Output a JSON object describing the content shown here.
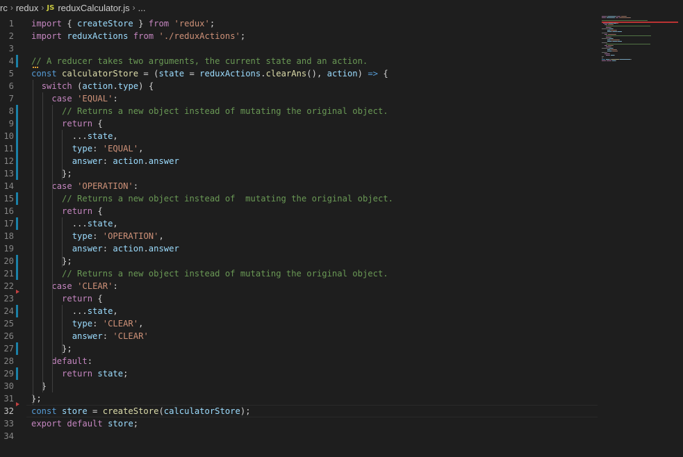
{
  "breadcrumb": {
    "items": [
      "rc",
      "redux",
      "reduxCalculator.js",
      "..."
    ],
    "js_badge": "JS"
  },
  "editor": {
    "lines": [
      {
        "n": "1",
        "tokens": [
          [
            "k",
            "import"
          ],
          [
            "p",
            " { "
          ],
          [
            "v",
            "createStore"
          ],
          [
            "p",
            " } "
          ],
          [
            "k",
            "from"
          ],
          [
            "p",
            " "
          ],
          [
            "s",
            "'redux'"
          ],
          [
            "p",
            ";"
          ]
        ]
      },
      {
        "n": "2",
        "tokens": [
          [
            "k",
            "import"
          ],
          [
            "p",
            " "
          ],
          [
            "v",
            "reduxActions"
          ],
          [
            "p",
            " "
          ],
          [
            "k",
            "from"
          ],
          [
            "p",
            " "
          ],
          [
            "s",
            "'./reduxActions'"
          ],
          [
            "p",
            ";"
          ]
        ]
      },
      {
        "n": "3",
        "tokens": []
      },
      {
        "n": "4",
        "tokens": [
          [
            "c",
            "// A reducer takes two arguments, the current state and an action."
          ]
        ]
      },
      {
        "n": "5",
        "tokens": [
          [
            "b",
            "const"
          ],
          [
            "p",
            " "
          ],
          [
            "f",
            "calculatorStore"
          ],
          [
            "p",
            " = ("
          ],
          [
            "v",
            "state"
          ],
          [
            "p",
            " = "
          ],
          [
            "v",
            "reduxActions"
          ],
          [
            "p",
            "."
          ],
          [
            "f",
            "clearAns"
          ],
          [
            "p",
            "(), "
          ],
          [
            "v",
            "action"
          ],
          [
            "p",
            ") "
          ],
          [
            "b",
            "=>"
          ],
          [
            "p",
            " {"
          ]
        ]
      },
      {
        "n": "6",
        "tokens": [
          [
            "p",
            "  "
          ],
          [
            "k",
            "switch"
          ],
          [
            "p",
            " ("
          ],
          [
            "v",
            "action"
          ],
          [
            "p",
            "."
          ],
          [
            "v",
            "type"
          ],
          [
            "p",
            ") {"
          ]
        ]
      },
      {
        "n": "7",
        "tokens": [
          [
            "p",
            "    "
          ],
          [
            "k",
            "case"
          ],
          [
            "p",
            " "
          ],
          [
            "s",
            "'EQUAL'"
          ],
          [
            "p",
            ":"
          ]
        ]
      },
      {
        "n": "8",
        "tokens": [
          [
            "p",
            "      "
          ],
          [
            "c",
            "// Returns a new object instead of mutating the original object."
          ]
        ]
      },
      {
        "n": "9",
        "tokens": [
          [
            "p",
            "      "
          ],
          [
            "k",
            "return"
          ],
          [
            "p",
            " {"
          ]
        ]
      },
      {
        "n": "10",
        "tokens": [
          [
            "p",
            "        ..."
          ],
          [
            "v",
            "state"
          ],
          [
            "p",
            ","
          ]
        ]
      },
      {
        "n": "11",
        "tokens": [
          [
            "p",
            "        "
          ],
          [
            "v",
            "type"
          ],
          [
            "p",
            ": "
          ],
          [
            "s",
            "'EQUAL'"
          ],
          [
            "p",
            ","
          ]
        ]
      },
      {
        "n": "12",
        "tokens": [
          [
            "p",
            "        "
          ],
          [
            "v",
            "answer"
          ],
          [
            "p",
            ": "
          ],
          [
            "v",
            "action"
          ],
          [
            "p",
            "."
          ],
          [
            "v",
            "answer"
          ]
        ]
      },
      {
        "n": "13",
        "tokens": [
          [
            "p",
            "      };"
          ]
        ]
      },
      {
        "n": "14",
        "tokens": [
          [
            "p",
            "    "
          ],
          [
            "k",
            "case"
          ],
          [
            "p",
            " "
          ],
          [
            "s",
            "'OPERATION'"
          ],
          [
            "p",
            ":"
          ]
        ]
      },
      {
        "n": "15",
        "tokens": [
          [
            "p",
            "      "
          ],
          [
            "c",
            "// Returns a new object instead of  mutating the original object."
          ]
        ]
      },
      {
        "n": "16",
        "tokens": [
          [
            "p",
            "      "
          ],
          [
            "k",
            "return"
          ],
          [
            "p",
            " {"
          ]
        ]
      },
      {
        "n": "17",
        "tokens": [
          [
            "p",
            "        ..."
          ],
          [
            "v",
            "state"
          ],
          [
            "p",
            ","
          ]
        ]
      },
      {
        "n": "18",
        "tokens": [
          [
            "p",
            "        "
          ],
          [
            "v",
            "type"
          ],
          [
            "p",
            ": "
          ],
          [
            "s",
            "'OPERATION'"
          ],
          [
            "p",
            ","
          ]
        ]
      },
      {
        "n": "19",
        "tokens": [
          [
            "p",
            "        "
          ],
          [
            "v",
            "answer"
          ],
          [
            "p",
            ": "
          ],
          [
            "v",
            "action"
          ],
          [
            "p",
            "."
          ],
          [
            "v",
            "answer"
          ]
        ]
      },
      {
        "n": "20",
        "tokens": [
          [
            "p",
            "      };"
          ]
        ]
      },
      {
        "n": "21",
        "tokens": [
          [
            "p",
            "      "
          ],
          [
            "c",
            "// Returns a new object instead of mutating the original object."
          ]
        ]
      },
      {
        "n": "22",
        "tokens": [
          [
            "p",
            "    "
          ],
          [
            "k",
            "case"
          ],
          [
            "p",
            " "
          ],
          [
            "s",
            "'CLEAR'"
          ],
          [
            "p",
            ":"
          ]
        ]
      },
      {
        "n": "23",
        "tokens": [
          [
            "p",
            "      "
          ],
          [
            "k",
            "return"
          ],
          [
            "p",
            " {"
          ]
        ]
      },
      {
        "n": "24",
        "tokens": [
          [
            "p",
            "        ..."
          ],
          [
            "v",
            "state"
          ],
          [
            "p",
            ","
          ]
        ]
      },
      {
        "n": "25",
        "tokens": [
          [
            "p",
            "        "
          ],
          [
            "v",
            "type"
          ],
          [
            "p",
            ": "
          ],
          [
            "s",
            "'CLEAR'"
          ],
          [
            "p",
            ","
          ]
        ]
      },
      {
        "n": "26",
        "tokens": [
          [
            "p",
            "        "
          ],
          [
            "v",
            "answer"
          ],
          [
            "p",
            ": "
          ],
          [
            "s",
            "'CLEAR'"
          ]
        ]
      },
      {
        "n": "27",
        "tokens": [
          [
            "p",
            "      };"
          ]
        ]
      },
      {
        "n": "28",
        "tokens": [
          [
            "p",
            "    "
          ],
          [
            "k",
            "default"
          ],
          [
            "p",
            ":"
          ]
        ]
      },
      {
        "n": "29",
        "tokens": [
          [
            "p",
            "      "
          ],
          [
            "k",
            "return"
          ],
          [
            "p",
            " "
          ],
          [
            "v",
            "state"
          ],
          [
            "p",
            ";"
          ]
        ]
      },
      {
        "n": "30",
        "tokens": [
          [
            "p",
            "  }"
          ]
        ]
      },
      {
        "n": "31",
        "tokens": [
          [
            "p",
            "};"
          ]
        ]
      },
      {
        "n": "32",
        "tokens": [
          [
            "b",
            "const"
          ],
          [
            "p",
            " "
          ],
          [
            "v",
            "store"
          ],
          [
            "p",
            " = "
          ],
          [
            "f",
            "createStore"
          ],
          [
            "p",
            "("
          ],
          [
            "v",
            "calculatorStore"
          ],
          [
            "p",
            ");"
          ]
        ]
      },
      {
        "n": "33",
        "tokens": [
          [
            "k",
            "export"
          ],
          [
            "p",
            " "
          ],
          [
            "k",
            "default"
          ],
          [
            "p",
            " "
          ],
          [
            "v",
            "store"
          ],
          [
            "p",
            ";"
          ]
        ]
      },
      {
        "n": "34",
        "tokens": []
      }
    ],
    "current_line": "32",
    "modified_lines": [
      "4",
      "8",
      "9",
      "10",
      "11",
      "12",
      "13",
      "15",
      "17",
      "20",
      "21",
      "24",
      "27",
      "29"
    ],
    "fold_marker_lines": [
      "23",
      "32"
    ]
  },
  "colors": {
    "background": "#1e1e1e",
    "keyword": "#c586c0",
    "string": "#ce9178",
    "comment": "#6a9955",
    "variable": "#9cdcfe",
    "function": "#dcdcaa",
    "storage": "#569cd6",
    "modified_gutter": "#1b81a8"
  }
}
